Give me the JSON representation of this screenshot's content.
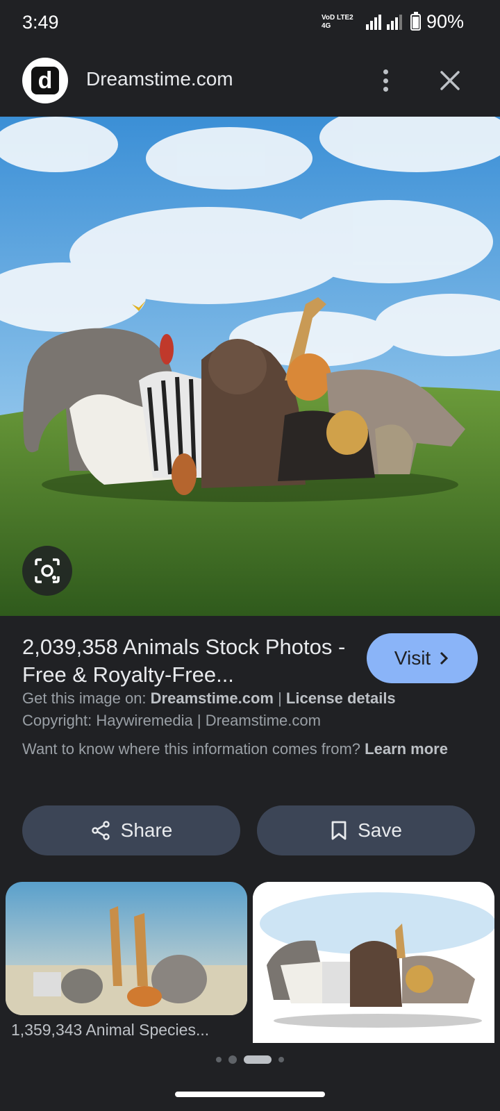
{
  "status_bar": {
    "time": "3:49",
    "network": "VoD LTE2 4G",
    "battery_percent": "90%",
    "battery_level": 0.9
  },
  "header": {
    "site_logo_letter": "d",
    "site_name": "Dreamstime.com"
  },
  "result": {
    "title": "2,039,358 Animals Stock Photos - Free & Royalty-Free...",
    "visit_label": "Visit",
    "source_prefix": "Get this image on: ",
    "source_site": "Dreamstime.com",
    "separator": " | ",
    "license_label": "License details",
    "copyright": "Copyright: Haywiremedia | Dreamstime.com",
    "learn_prefix": "Want to know where this information comes from? ",
    "learn_more": "Learn more"
  },
  "actions": {
    "share_label": "Share",
    "save_label": "Save"
  },
  "related": {
    "first_caption": "1,359,343 Animal Species..."
  },
  "colors": {
    "background": "#202124",
    "accent": "#8ab4f8",
    "button_bg": "#3c4556"
  }
}
